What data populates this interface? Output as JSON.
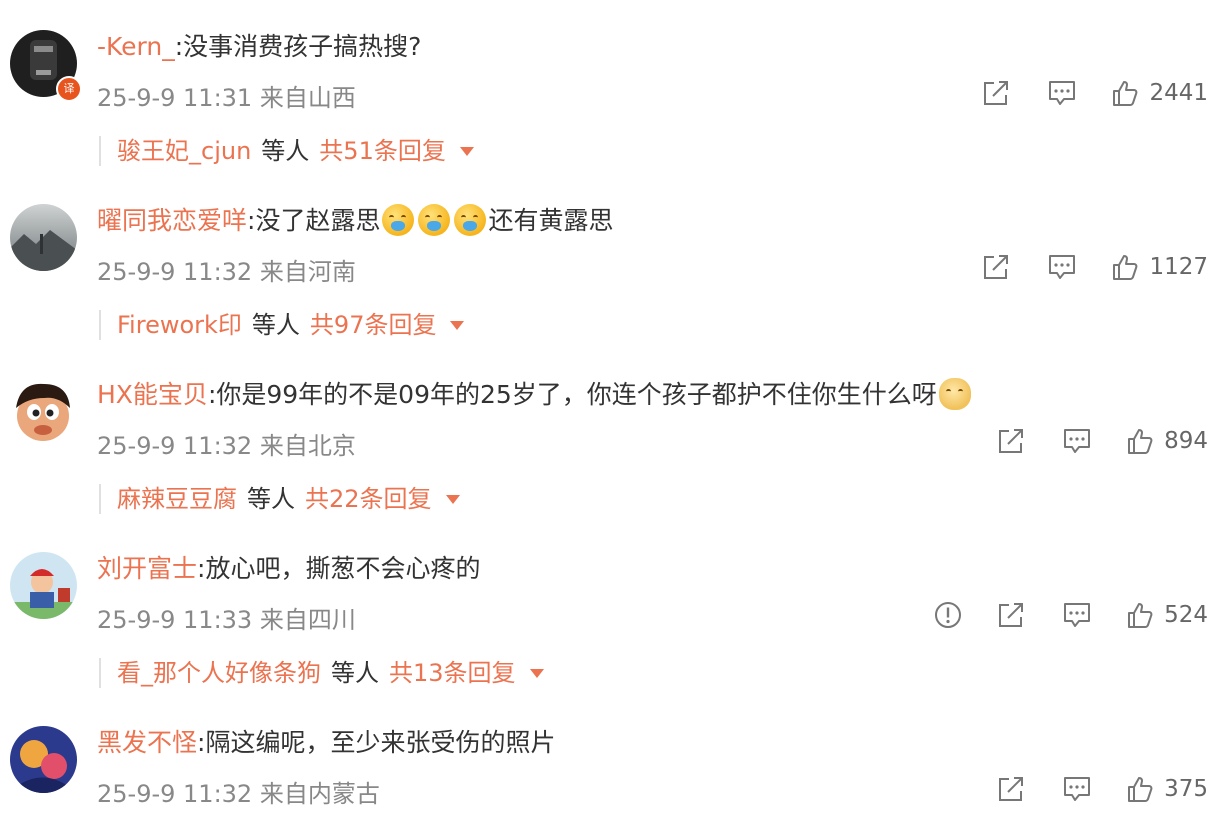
{
  "comments": [
    {
      "user": "-Kern_",
      "text": "没事消费孩子搞热搜?",
      "time": "25-9-9 11:31",
      "location": "来自山西",
      "likes": "2441",
      "badge": "译",
      "reply_user": "骏王妃_cjun",
      "reply_mid": "等人",
      "reply_total": "共51条回复"
    },
    {
      "user": "曜同我恋爱咩",
      "text": "没了赵露思",
      "text2": "还有黄露思",
      "time": "25-9-9 11:32",
      "location": "来自河南",
      "likes": "1127",
      "reply_user": "Firework印",
      "reply_mid": "等人",
      "reply_total": "共97条回复"
    },
    {
      "user": "HX能宝贝",
      "text": "你是99年的不是09年的25岁了，你连个孩子都护不住你生什么呀",
      "time": "25-9-9 11:32",
      "location": "来自北京",
      "likes": "894",
      "reply_user": "麻辣豆豆腐",
      "reply_mid": "等人",
      "reply_total": "共22条回复"
    },
    {
      "user": "刘开富士",
      "text": "放心吧，撕葱不会心疼的",
      "time": "25-9-9 11:33",
      "location": "来自四川",
      "likes": "524",
      "reply_user": "看_那个人好像条狗",
      "reply_mid": "等人",
      "reply_total": "共13条回复"
    },
    {
      "user": "黑发不怪",
      "text": "隔这编呢，至少来张受伤的照片",
      "time": "25-9-9 11:32",
      "location": "来自内蒙古",
      "likes": "375"
    }
  ],
  "icons": {
    "share": "share-icon",
    "comment": "comment-icon",
    "like": "like-icon",
    "report": "report-icon",
    "more": "caret-down-icon"
  },
  "colors": {
    "username": "#eb7350",
    "meta": "#888888",
    "text": "#333333"
  }
}
